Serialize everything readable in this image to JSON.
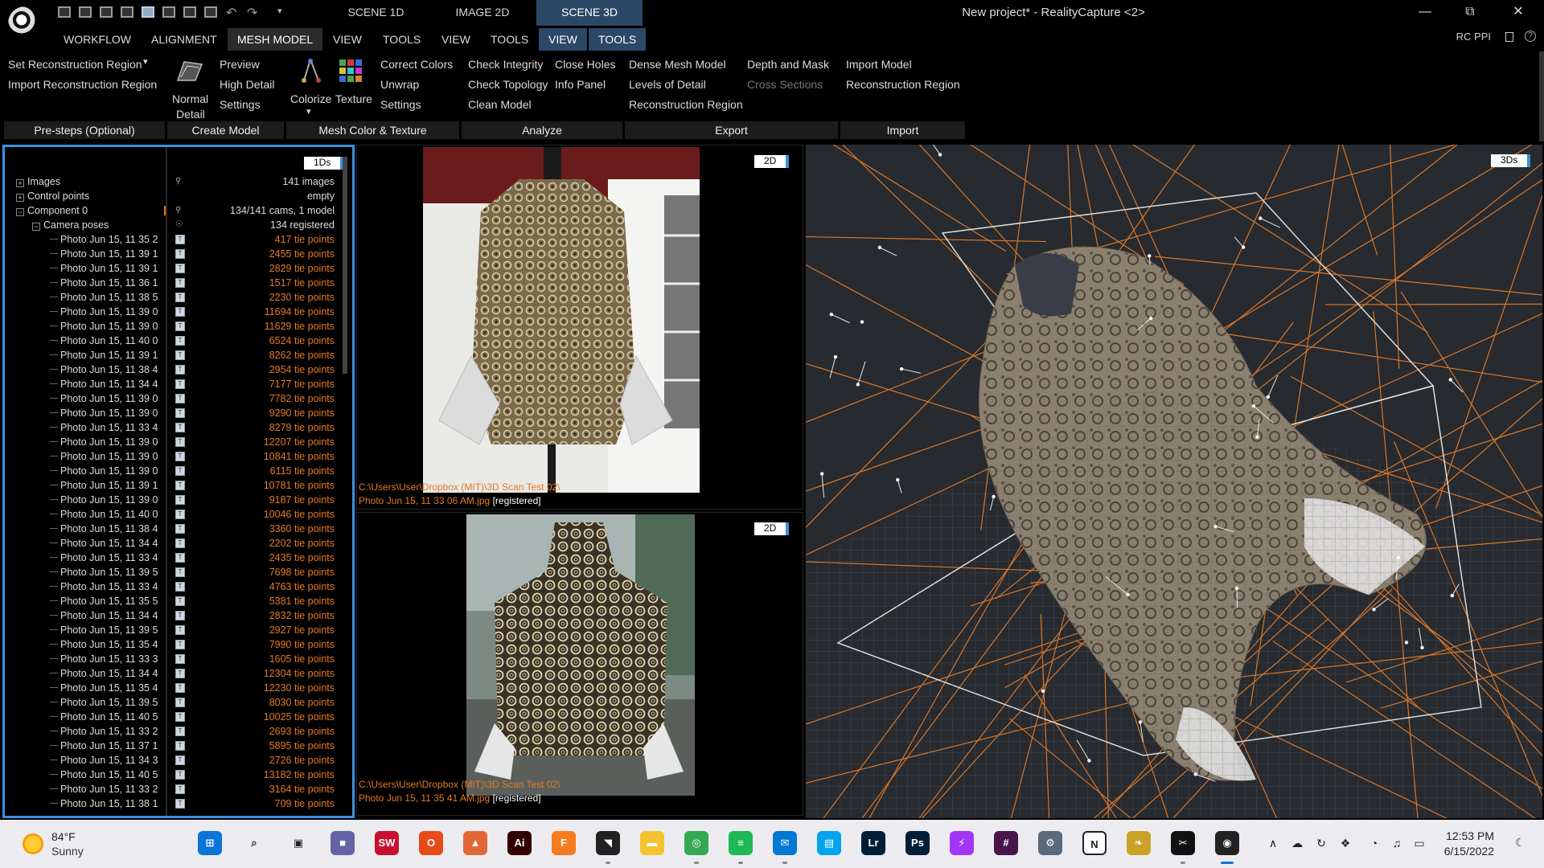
{
  "titlebar": {
    "scene_tabs": [
      "SCENE 1D",
      "IMAGE 2D",
      "SCENE 3D"
    ],
    "window_title": "New project* - RealityCapture <2>",
    "minimize": "—",
    "restore": "⧉",
    "close": "✕",
    "qa_undo": "↶",
    "qa_redo": "↷",
    "qa_menu": "▾"
  },
  "menubar": {
    "items": [
      "WORKFLOW",
      "ALIGNMENT",
      "MESH MODEL",
      "VIEW",
      "TOOLS",
      "VIEW",
      "TOOLS",
      "VIEW",
      "TOOLS"
    ],
    "rc_ppi": "RC PPI",
    "help": "?"
  },
  "ribbon": {
    "pre_steps": {
      "set_region": "Set Reconstruction Region",
      "set_region_arrow": "▾",
      "import_region": "Import Reconstruction Region",
      "label": "Pre-steps (Optional)"
    },
    "create_model": {
      "normal_detail_1": "Normal",
      "normal_detail_2": "Detail",
      "preview": "Preview",
      "high_detail": "High Detail",
      "settings": "Settings",
      "label": "Create Model"
    },
    "mesh_color": {
      "colorize": "Colorize",
      "texture": "Texture",
      "arrow": "▾",
      "correct_colors": "Correct Colors",
      "unwrap": "Unwrap",
      "settings": "Settings",
      "label": "Mesh Color & Texture"
    },
    "analyze": {
      "check_integrity": "Check Integrity",
      "check_topology": "Check Topology",
      "clean_model": "Clean Model",
      "close_holes": "Close Holes",
      "info_panel": "Info Panel",
      "label": "Analyze"
    },
    "export": {
      "dense_mesh": "Dense Mesh Model",
      "levels_of_detail": "Levels of Detail",
      "reconstruction_region": "Reconstruction Region",
      "depth_and_mask": "Depth and Mask",
      "cross_sections": "Cross Sections",
      "label": "Export"
    },
    "import": {
      "import_model": "Import Model",
      "reconstruction_region": "Reconstruction Region",
      "label": "Import"
    }
  },
  "panel_1d": {
    "badge": "1Ds",
    "tree": [
      {
        "label": "Images",
        "value": "141 images",
        "kind": "group",
        "exp": "+"
      },
      {
        "label": "Control points",
        "value": "empty",
        "kind": "group",
        "exp": "+"
      },
      {
        "label": "Component 0",
        "value": "134/141 cams, 1 model",
        "kind": "group",
        "exp": "−"
      },
      {
        "label": "Camera poses",
        "value": "134 registered",
        "kind": "sub",
        "exp": "−"
      }
    ],
    "photos": [
      {
        "name": "Photo Jun 15, 11 35 2",
        "tie": "417 tie points"
      },
      {
        "name": "Photo Jun 15, 11 39 1",
        "tie": "2455 tie points"
      },
      {
        "name": "Photo Jun 15, 11 39 1",
        "tie": "2829 tie points"
      },
      {
        "name": "Photo Jun 15, 11 36 1",
        "tie": "1517 tie points"
      },
      {
        "name": "Photo Jun 15, 11 38 5",
        "tie": "2230 tie points"
      },
      {
        "name": "Photo Jun 15, 11 39 0",
        "tie": "11694 tie points"
      },
      {
        "name": "Photo Jun 15, 11 39 0",
        "tie": "11629 tie points"
      },
      {
        "name": "Photo Jun 15, 11 40 0",
        "tie": "6524 tie points"
      },
      {
        "name": "Photo Jun 15, 11 39 1",
        "tie": "8262 tie points"
      },
      {
        "name": "Photo Jun 15, 11 38 4",
        "tie": "2954 tie points"
      },
      {
        "name": "Photo Jun 15, 11 34 4",
        "tie": "7177 tie points"
      },
      {
        "name": "Photo Jun 15, 11 39 0",
        "tie": "7782 tie points"
      },
      {
        "name": "Photo Jun 15, 11 39 0",
        "tie": "9290 tie points"
      },
      {
        "name": "Photo Jun 15, 11 33 4",
        "tie": "8279 tie points"
      },
      {
        "name": "Photo Jun 15, 11 39 0",
        "tie": "12207 tie points"
      },
      {
        "name": "Photo Jun 15, 11 39 0",
        "tie": "10841 tie points"
      },
      {
        "name": "Photo Jun 15, 11 39 0",
        "tie": "6115 tie points"
      },
      {
        "name": "Photo Jun 15, 11 39 1",
        "tie": "10781 tie points"
      },
      {
        "name": "Photo Jun 15, 11 39 0",
        "tie": "9187 tie points"
      },
      {
        "name": "Photo Jun 15, 11 40 0",
        "tie": "10046 tie points"
      },
      {
        "name": "Photo Jun 15, 11 38 4",
        "tie": "3360 tie points"
      },
      {
        "name": "Photo Jun 15, 11 34 4",
        "tie": "2202 tie points"
      },
      {
        "name": "Photo Jun 15, 11 33 4",
        "tie": "2435 tie points"
      },
      {
        "name": "Photo Jun 15, 11 39 5",
        "tie": "7698 tie points"
      },
      {
        "name": "Photo Jun 15, 11 33 4",
        "tie": "4763 tie points"
      },
      {
        "name": "Photo Jun 15, 11 35 5",
        "tie": "5381 tie points"
      },
      {
        "name": "Photo Jun 15, 11 34 4",
        "tie": "2832 tie points"
      },
      {
        "name": "Photo Jun 15, 11 39 5",
        "tie": "2927 tie points"
      },
      {
        "name": "Photo Jun 15, 11 35 4",
        "tie": "7990 tie points"
      },
      {
        "name": "Photo Jun 15, 11 33 3",
        "tie": "1605 tie points"
      },
      {
        "name": "Photo Jun 15, 11 34 4",
        "tie": "12304 tie points"
      },
      {
        "name": "Photo Jun 15, 11 35 4",
        "tie": "12230 tie points"
      },
      {
        "name": "Photo Jun 15, 11 39 5",
        "tie": "8030 tie points"
      },
      {
        "name": "Photo Jun 15, 11 40 5",
        "tie": "10025 tie points"
      },
      {
        "name": "Photo Jun 15, 11 33 2",
        "tie": "2693 tie points"
      },
      {
        "name": "Photo Jun 15, 11 37 1",
        "tie": "5895 tie points"
      },
      {
        "name": "Photo Jun 15, 11 34 3",
        "tie": "2726 tie points"
      },
      {
        "name": "Photo Jun 15, 11 40 5",
        "tie": "13182 tie points"
      },
      {
        "name": "Photo Jun 15, 11 33 2",
        "tie": "3164 tie points"
      },
      {
        "name": "Photo Jun 15, 11 38 1",
        "tie": "709 tie points"
      }
    ]
  },
  "panel_2d_top": {
    "badge": "2D",
    "path": "C:\\Users\\User\\Dropbox (MIT)\\3D Scan Test 02\\",
    "filename": "Photo Jun 15, 11 33 06 AM.jpg",
    "status": "[registered]"
  },
  "panel_2d_bottom": {
    "badge": "2D",
    "path": "C:\\Users\\User\\Dropbox (MIT)\\3D Scan Test 02\\",
    "filename": "Photo Jun 15, 11 35 41 AM.jpg",
    "status": "[registered]"
  },
  "panel_3d": {
    "badge": "3Ds"
  },
  "taskbar": {
    "weather_temp": "84°F",
    "weather_desc": "Sunny",
    "apps": [
      {
        "name": "windows-start-icon",
        "glyph": "⊞",
        "bg": "#0a74d8"
      },
      {
        "name": "search-icon",
        "glyph": "⌕",
        "bg": "transparent"
      },
      {
        "name": "task-view-icon",
        "glyph": "▣",
        "bg": "transparent"
      },
      {
        "name": "teams-chat-icon",
        "glyph": "■",
        "bg": "#6264a7"
      },
      {
        "name": "solidworks-icon",
        "glyph": "SW",
        "bg": "#c8102e"
      },
      {
        "name": "office-icon",
        "glyph": "O",
        "bg": "#e64a19"
      },
      {
        "name": "matlab-icon",
        "glyph": "▲",
        "bg": "#e16737"
      },
      {
        "name": "illustrator-icon",
        "glyph": "Ai",
        "bg": "#330000"
      },
      {
        "name": "fusion360-icon",
        "glyph": "F",
        "bg": "#f47b20"
      },
      {
        "name": "sticky-notes-icon",
        "glyph": "◥",
        "bg": "#222222"
      },
      {
        "name": "file-explorer-icon",
        "glyph": "▬",
        "bg": "#f4c430"
      },
      {
        "name": "chrome-icon",
        "glyph": "◎",
        "bg": "#34a853"
      },
      {
        "name": "spotify-icon",
        "glyph": "≡",
        "bg": "#1db954"
      },
      {
        "name": "mail-icon",
        "glyph": "✉",
        "bg": "#0078d4"
      },
      {
        "name": "store-icon",
        "glyph": "▤",
        "bg": "#00a4ef"
      },
      {
        "name": "lightroom-icon",
        "glyph": "Lr",
        "bg": "#001e36"
      },
      {
        "name": "photoshop-icon",
        "glyph": "Ps",
        "bg": "#001e36"
      },
      {
        "name": "messenger-icon",
        "glyph": "⚡",
        "bg": "#a334fa"
      },
      {
        "name": "slack-icon",
        "glyph": "#",
        "bg": "#4a154b"
      },
      {
        "name": "settings-icon",
        "glyph": "⚙",
        "bg": "#5a6a7a"
      },
      {
        "name": "notion-icon",
        "glyph": "N",
        "bg": "#ffffff"
      },
      {
        "name": "rhino-icon",
        "glyph": "❧",
        "bg": "#c9a227"
      },
      {
        "name": "capcut-icon",
        "glyph": "✂",
        "bg": "#111111"
      },
      {
        "name": "realitycapture-icon",
        "glyph": "◉",
        "bg": "#222222"
      }
    ],
    "tray": {
      "chevron": "∧",
      "cloud": "☁",
      "sync": "↻",
      "dropbox": "❖",
      "wifi": "◔",
      "volume": "♫",
      "battery": "▭"
    },
    "clock_time": "12:53 PM",
    "clock_date": "6/15/2022",
    "notif": "☾"
  },
  "colors": {
    "accent_blue": "#3d8fe0",
    "tie_orange": "#e47a22",
    "active_tab": "#2b4866"
  }
}
